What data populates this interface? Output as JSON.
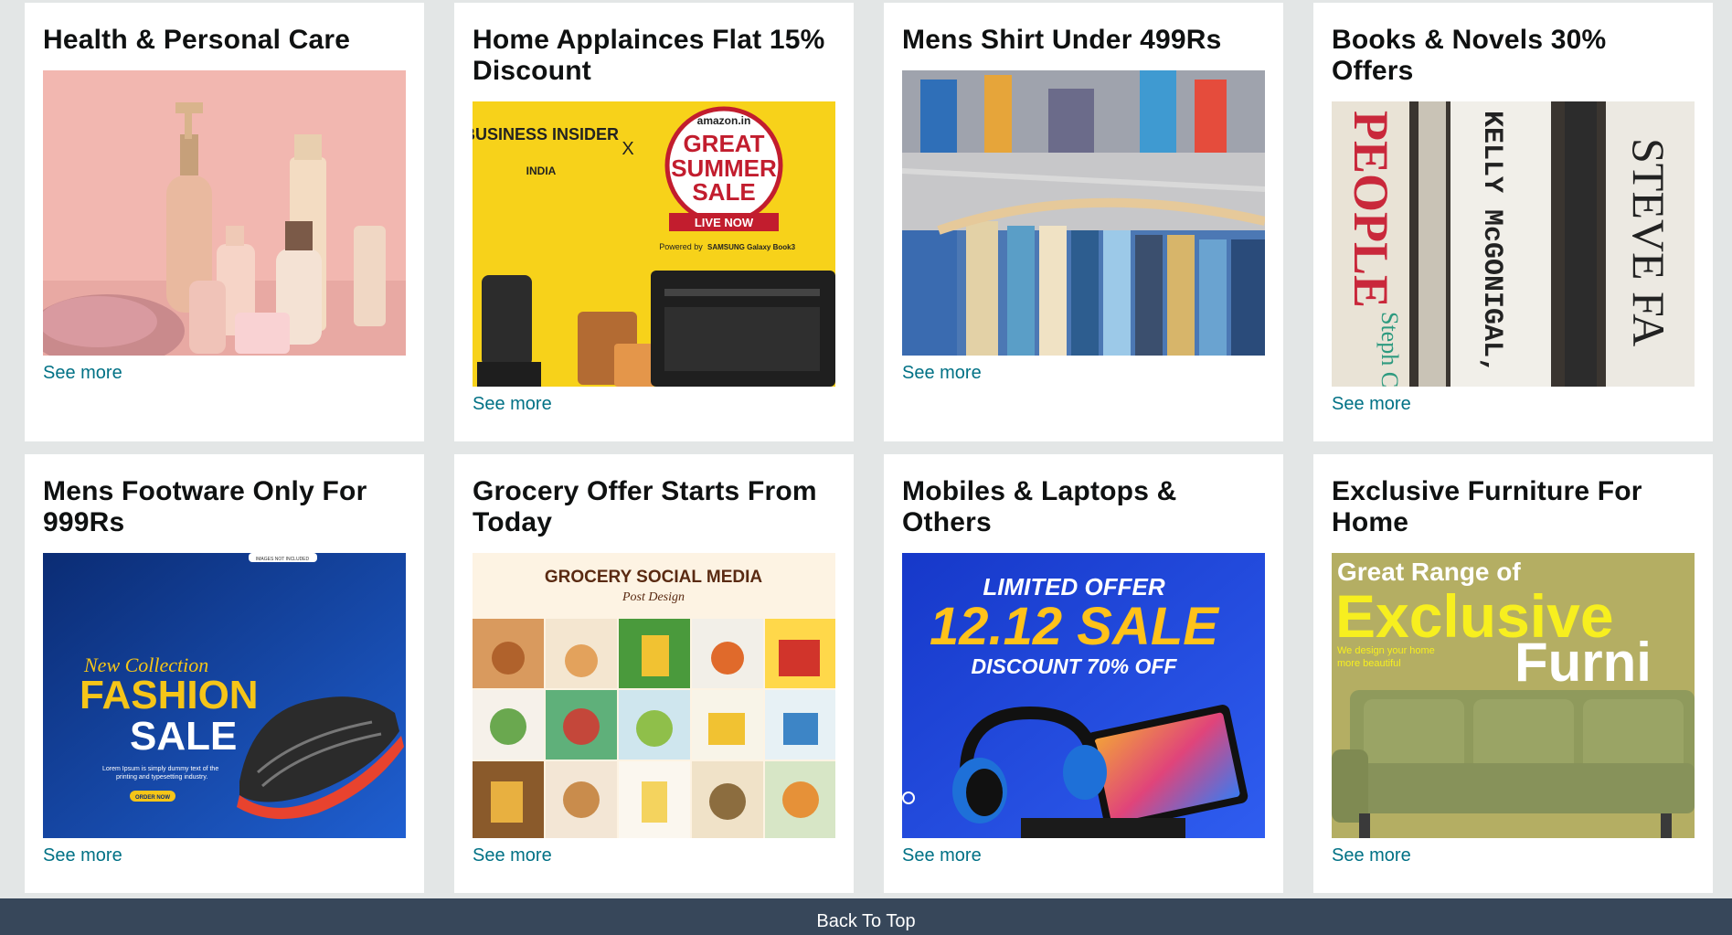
{
  "cards": [
    {
      "title": "Health & Personal Care",
      "link": "See more",
      "image": "cosmetic-bottles-image"
    },
    {
      "title": "Home Applainces Flat 15% Discount",
      "link": "See more",
      "image": "summer-sale-appliances-image",
      "image_text": {
        "brand": "BUSINESS INSIDER",
        "brand_sub": "INDIA",
        "x": "X",
        "store": "amazon.in",
        "sale1": "GREAT",
        "sale2": "SUMMER",
        "sale3": "SALE",
        "live": "LIVE NOW",
        "powered": "Powered by",
        "sponsor": "SAMSUNG Galaxy Book3"
      }
    },
    {
      "title": "Mens Shirt Under 499Rs",
      "link": "See more",
      "image": "shirts-on-rack-image"
    },
    {
      "title": "Books & Novels 30% Offers",
      "link": "See more",
      "image": "book-spines-image",
      "image_text": {
        "spine1": "PEOPLE",
        "spine1b": "Steph Covey",
        "spine2": "KELLY McGONIGAL, PhD",
        "spine3": "STEVE FA"
      }
    },
    {
      "title": "Mens Footware Only For 999Rs",
      "link": "See more",
      "image": "fashion-sale-shoe-image",
      "image_text": {
        "top": "IMAGES NOT INCLUDED",
        "line1": "New Collection",
        "line2": "FASHION",
        "line3": "SALE",
        "body": "Lorem Ipsum is simply dummy text of the printing and typesetting industry.",
        "cta": "ORDER NOW"
      }
    },
    {
      "title": "Grocery Offer Starts From Today",
      "link": "See more",
      "image": "grocery-post-grid-image",
      "image_text": {
        "heading": "GROCERY SOCIAL MEDIA",
        "sub": "Post Design"
      }
    },
    {
      "title": "Mobiles & Laptops & Others",
      "link": "See more",
      "image": "electronics-sale-image",
      "image_text": {
        "line1": "LIMITED OFFER",
        "line2": "12.12 SALE",
        "line3": "DISCOUNT 70% OFF"
      }
    },
    {
      "title": "Exclusive Furniture For Home",
      "link": "See more",
      "image": "furniture-sofa-image",
      "image_text": {
        "line1": "Great Range of",
        "line2": "Exclusive",
        "line3": "We design your home more beautiful",
        "line4": "Furni"
      }
    }
  ],
  "footer": {
    "back_to_top": "Back To Top"
  },
  "colors": {
    "link": "#007185",
    "footer_bg": "#37475a",
    "page_bg": "#e3e6e6"
  }
}
